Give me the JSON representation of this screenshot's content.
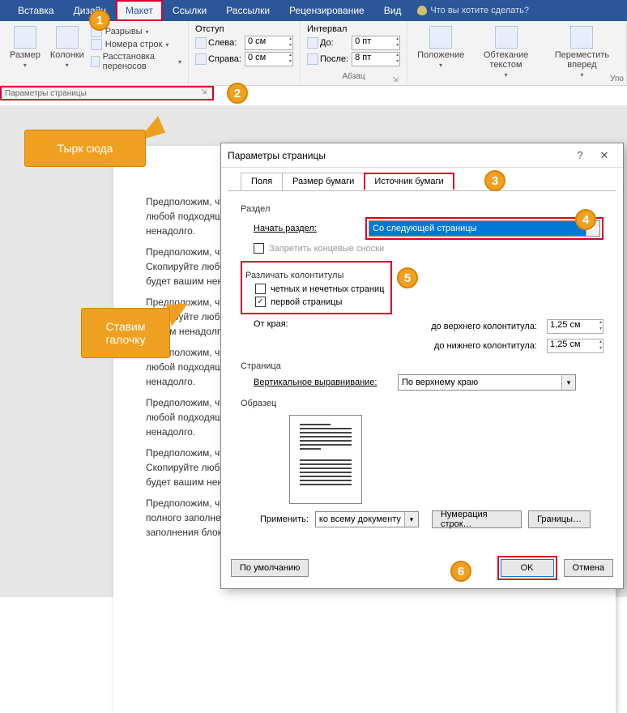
{
  "ribbon": {
    "tabs": [
      "Вставка",
      "Дизайн",
      "Макет",
      "Ссылки",
      "Рассылки",
      "Рецензирование",
      "Вид"
    ],
    "active_tab": "Макет",
    "tellme": "Что вы хотите сделать?",
    "size_label": "Размер",
    "columns_label": "Колонки",
    "breaks_label": "Разрывы",
    "line_numbers_label": "Номера строк",
    "hyphenation_label": "Расстановка переносов",
    "page_setup_group": "Параметры страницы",
    "indent_group_title": "Отступ",
    "indent_left_label": "Слева:",
    "indent_left_value": "0 см",
    "indent_right_label": "Справа:",
    "indent_right_value": "0 см",
    "spacing_group_title": "Интервал",
    "spacing_before_label": "До:",
    "spacing_before_value": "0 пт",
    "spacing_after_label": "После:",
    "spacing_after_value": "8 пт",
    "paragraph_group": "Абзац",
    "position_label": "Положение",
    "wrap_label": "Обтекание текстом",
    "forward_label": "Переместить вперед",
    "arrange_group": "Упо"
  },
  "callouts": {
    "n1": "1",
    "n2": "2",
    "n3": "3",
    "n4": "4",
    "n5": "5",
    "n6": "6",
    "c1_text": "Тырк сюда",
    "c2_text": "Ставим галочку"
  },
  "dialog": {
    "title": "Параметры страницы",
    "tab_fields": "Поля",
    "tab_paper": "Размер бумаги",
    "tab_source": "Источник бумаги",
    "section_label": "Раздел",
    "start_label": "Начать раздел:",
    "start_value": "Со следующей страницы",
    "no_endnotes": "Запретить концевые сноски",
    "headers_group": "Различать колонтитулы",
    "odd_even": "четных и нечетных страниц",
    "first_page": "первой страницы",
    "from_edge": "От края:",
    "header_dist_label": "до верхнего колонтитула:",
    "header_dist_value": "1,25 см",
    "footer_dist_label": "до нижнего колонтитула:",
    "footer_dist_value": "1,25 см",
    "page_label": "Страница",
    "valign_label": "Вертикальное выравнивание:",
    "valign_value": "По верхнему краю",
    "preview_label": "Образец",
    "apply_label": "Применить:",
    "apply_value": "ко всему документу",
    "line_numbers_btn": "Нумерация строк…",
    "borders_btn": "Границы…",
    "default_btn": "По умолчанию",
    "ok_btn": "OK",
    "cancel_btn": "Отмена"
  },
  "doc": {
    "p1": "Предположим, что вам нужен текст чисто для заполнения блока на веб-странице. Скопируйте любой подходящий постоянный текст с любого сайта. Понятно что текст этот будет вашим ненадолго.",
    "p2": "Предположим, что вам нужен текст чисто для заполнения по за блока на веб-странице. Скопируйте любой подходящий по за постоянный текст с любого сайта. Понятно что текст этот будет вашим ненадолго.",
    "p3": "Предположим, что вам нужен текст чисто для заполнения по за блока на веб-странице. Скопируйте любой подходящий постоянный текст с любого сайта. Понятно что текст этот будет вашим ненадолго.",
    "p4": "Предположим, что вам нужен текст чисто для заполнения блока на веб-странице. Скопируйте любой подходящий постоянный текст с любого сайта. Понятно что текст этот будет вашим ненадолго.",
    "p5": "Предположим, что вам нужен текст чисто для заполнения блока на веб-странице. Скопируйте любой подходящий постоянный текст с любого сайта. Понятно что текст этот будет вашим ненадолго.",
    "p6": "Предположим, что вам нужен текст чисто для заполнения по за блока на веб-странице. Скопируйте любой подходящий постоянный текст с любого сайта. Понятно что текст этот и будет вашим ненадолго.",
    "p7": "Предположим, что вам нужен текст чисто для заполнения по за блока, а сейчас для более полного заполнения блока текстовой информацией постоянным. А сейчас для более полного заполнения блока текстовой инфор мацией"
  }
}
